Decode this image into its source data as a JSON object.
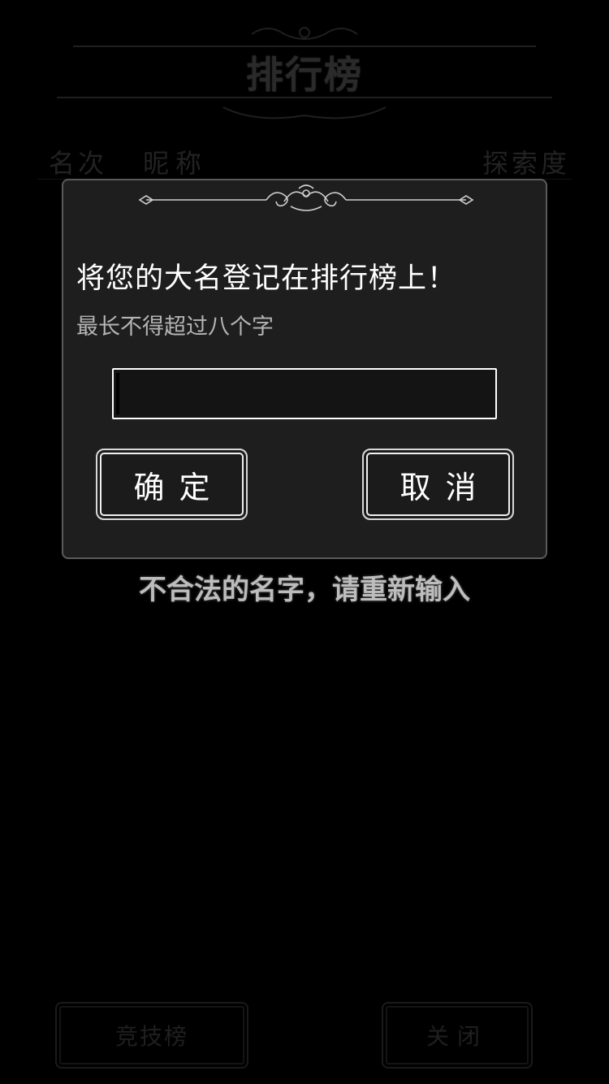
{
  "background": {
    "title": "排行榜",
    "columns": {
      "rank": "名次",
      "nickname": "昵称",
      "score": "探索度"
    },
    "buttons": {
      "arena": "竞技榜",
      "close": "关闭"
    }
  },
  "dialog": {
    "title": "将您的大名登记在排行榜上！",
    "hint": "最长不得超过八个字",
    "input": {
      "value": "",
      "placeholder": ""
    },
    "confirm_label": "确定",
    "cancel_label": "取消"
  },
  "error_message": "不合法的名字，请重新输入",
  "colors": {
    "background": "#000000",
    "dialog_bg": "#1e1e1e",
    "dialog_border": "#5a5a5a",
    "button_border": "#f0f0f0",
    "error_text": "#bdbdbd"
  }
}
